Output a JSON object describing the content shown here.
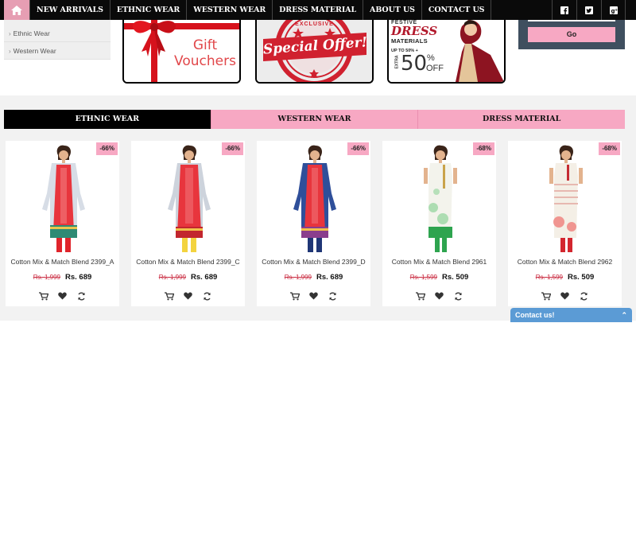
{
  "nav": {
    "home_icon": "home-icon",
    "items": [
      "NEW ARRIVALS",
      "ETHNIC WEAR",
      "WESTERN WEAR",
      "DRESS MATERIAL",
      "ABOUT US",
      "CONTACT US"
    ],
    "social": [
      "facebook-icon",
      "twitter-icon",
      "google-plus-icon"
    ]
  },
  "sidebar": {
    "links": [
      "Ethnic Wear",
      "Western Wear"
    ]
  },
  "banners": {
    "gift": {
      "line1": "Gift",
      "line2": "Vouchers"
    },
    "offer": {
      "text": "Special Offer!",
      "ring": "EXCLUSIVE"
    },
    "festive": {
      "line1": "FESTIVE",
      "line2": "DRESS",
      "line3": "MATERIALS",
      "upto": "UP TO 50% +",
      "big": "50",
      "pct": "%",
      "off": "OFF",
      "extra": "EXTRA",
      "plus": "+"
    }
  },
  "newsletter": {
    "button": "Go"
  },
  "tabs": [
    "ETHNIC WEAR",
    "WESTERN WEAR",
    "DRESS MATERIAL"
  ],
  "products": [
    {
      "name": "Cotton Mix & Match Blend 2399_A",
      "old_price": "Rs. 1,999",
      "price": "Rs. 689",
      "discount": "-66%"
    },
    {
      "name": "Cotton Mix & Match Blend 2399_C",
      "old_price": "Rs. 1,999",
      "price": "Rs. 689",
      "discount": "-66%"
    },
    {
      "name": "Cotton Mix & Match Blend 2399_D",
      "old_price": "Rs. 1,999",
      "price": "Rs. 689",
      "discount": "-66%"
    },
    {
      "name": "Cotton Mix & Match Blend 2961",
      "old_price": "Rs. 1,599",
      "price": "Rs. 509",
      "discount": "-68%"
    },
    {
      "name": "Cotton Mix & Match Blend 2962",
      "old_price": "Rs. 1,599",
      "price": "Rs. 509",
      "discount": "-68%"
    }
  ],
  "contact": {
    "label": "Contact us!"
  },
  "colors": {
    "accent": "#f7a8c3",
    "nav": "#0a0a0a",
    "home": "#e69eb3",
    "contact": "#5b9bd5"
  }
}
